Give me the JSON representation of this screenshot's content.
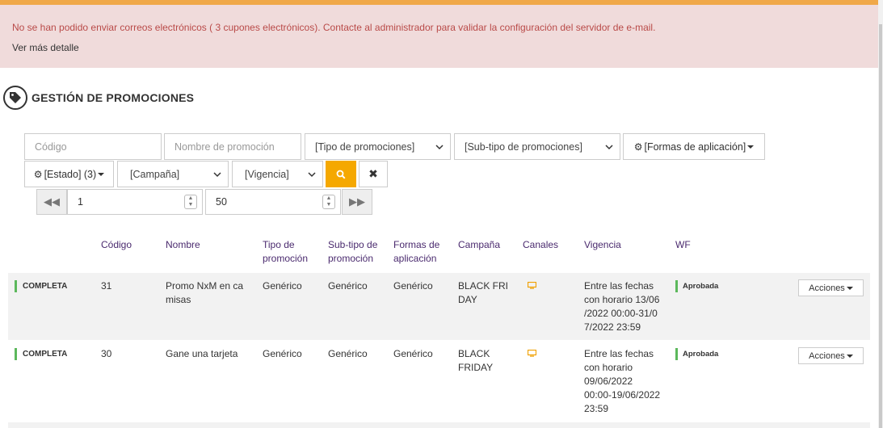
{
  "alert": {
    "message": "No se han podido enviar correos electrónicos ( 3 cupones electrónicos). Contacte al administrador para validar la configuración del servidor de e-mail.",
    "more_link": "Ver más detalle"
  },
  "page": {
    "title": "GESTIÓN DE PROMOCIONES"
  },
  "filters": {
    "codigo_placeholder": "Código",
    "nombre_placeholder": "Nombre de promoción",
    "tipo": "[Tipo de promociones]",
    "subtipo": "[Sub-tipo de promociones]",
    "formas": "[Formas de aplicación]",
    "estado": "[Estado] (3)",
    "campana": "[Campaña]",
    "vigencia": "[Vigencia]"
  },
  "pagination": {
    "page": "1",
    "page_size": "50"
  },
  "table": {
    "headers": {
      "codigo": "Código",
      "nombre": "Nombre",
      "tipo": [
        "Tipo de",
        "promoción"
      ],
      "subtipo": [
        "Sub-tipo de",
        "promoción"
      ],
      "formas": [
        "Formas de",
        "aplicación"
      ],
      "campana": "Campaña",
      "canales": "Canales",
      "vigencia": "Vigencia",
      "wf": "WF"
    },
    "rows": [
      {
        "status": "COMPLETA",
        "codigo": "31",
        "nombre": [
          "Promo NxM en ca",
          "misas"
        ],
        "tipo": "Genérico",
        "subtipo": "Genérico",
        "formas": "Genérico",
        "campana": [
          "BLACK FRI",
          "DAY"
        ],
        "vigencia": [
          "Entre las fechas",
          "con horario 13/06",
          "/2022 00:00-31/0",
          "7/2022 23:59"
        ],
        "wf": "Aprobada",
        "acciones": "Acciones"
      },
      {
        "status": "COMPLETA",
        "codigo": "30",
        "nombre": [
          "Gane una tarjeta"
        ],
        "tipo": "Genérico",
        "subtipo": "Genérico",
        "formas": "Genérico",
        "campana": [
          "BLACK",
          "FRIDAY"
        ],
        "vigencia": [
          "Entre las fechas",
          "con horario",
          "09/06/2022",
          "00:00-19/06/2022",
          "23:59"
        ],
        "wf": "Aprobada",
        "acciones": "Acciones"
      }
    ]
  },
  "colors": {
    "accent": "#f5a800",
    "alert_bg": "#f0dbdb",
    "alert_text": "#b94a48",
    "header_text": "#4a2a6e",
    "ok_green": "#5cb85c"
  }
}
